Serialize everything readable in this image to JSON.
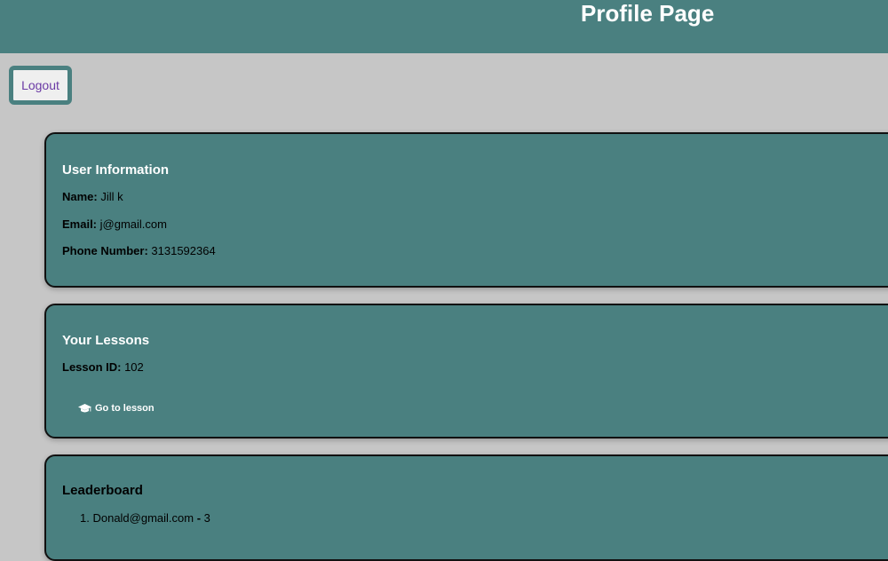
{
  "header": {
    "title": "Profile Page"
  },
  "logout": {
    "label": "Logout"
  },
  "user_info": {
    "title": "User Information",
    "name_label": "Name:",
    "name_value": " Jill k",
    "email_label": "Email:",
    "email_value": " j@gmail.com",
    "phone_label": "Phone Number:",
    "phone_value": " 3131592364"
  },
  "lessons": {
    "title": "Your Lessons",
    "lesson_id_label": "Lesson ID:",
    "lesson_id_value": " 102",
    "go_button_label": "Go to lesson",
    "go_button_icon": "graduation-cap-icon"
  },
  "leaderboard": {
    "title": "Leaderboard",
    "entries": [
      {
        "rank": "1.",
        "email": "Donald@gmail.com",
        "sep": " - ",
        "score": "3"
      }
    ]
  },
  "colors": {
    "header_bg": "#4a8080",
    "page_bg": "#c6c6c6",
    "card_bg": "#4a8080",
    "logout_text": "#6b3aa5"
  }
}
